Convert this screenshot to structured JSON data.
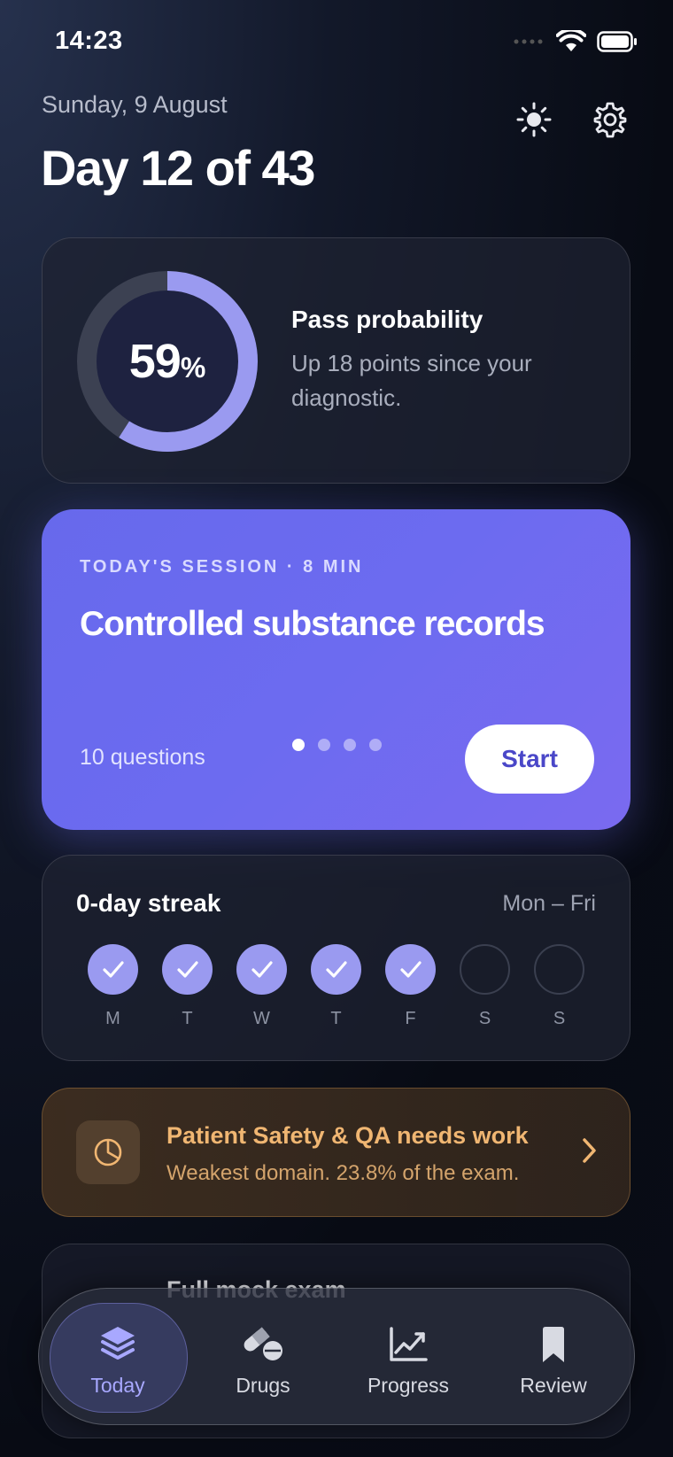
{
  "status_bar": {
    "time": "14:23"
  },
  "header": {
    "date": "Sunday, 9 August",
    "title": "Day 12 of 43"
  },
  "probability": {
    "value": "59",
    "unit": "%",
    "fraction": 0.59,
    "title": "Pass probability",
    "subtitle": "Up 18 points since your diagnostic."
  },
  "session": {
    "label": "TODAY'S SESSION · 8 MIN",
    "title": "Controlled substance records",
    "questions": "10 questions",
    "page_count": 4,
    "active_page": 1,
    "start_label": "Start"
  },
  "streak": {
    "title": "0-day streak",
    "range": "Mon – Fri",
    "days": [
      {
        "letter": "M",
        "done": true
      },
      {
        "letter": "T",
        "done": true
      },
      {
        "letter": "W",
        "done": true
      },
      {
        "letter": "T",
        "done": true
      },
      {
        "letter": "F",
        "done": true
      },
      {
        "letter": "S",
        "done": false
      },
      {
        "letter": "S",
        "done": false
      }
    ]
  },
  "weakness": {
    "title": "Patient Safety & QA needs work",
    "subtitle": "Weakest domain. 23.8% of the exam."
  },
  "mock": {
    "title": "Full mock exam"
  },
  "tabs": [
    {
      "label": "Today",
      "icon": "layers-icon",
      "active": true
    },
    {
      "label": "Drugs",
      "icon": "pills-icon",
      "active": false
    },
    {
      "label": "Progress",
      "icon": "chart-icon",
      "active": false
    },
    {
      "label": "Review",
      "icon": "bookmark-icon",
      "active": false
    }
  ],
  "colors": {
    "accent": "#6c6bf0",
    "ring_fill": "#9a9af0",
    "warning": "#f0b672"
  }
}
